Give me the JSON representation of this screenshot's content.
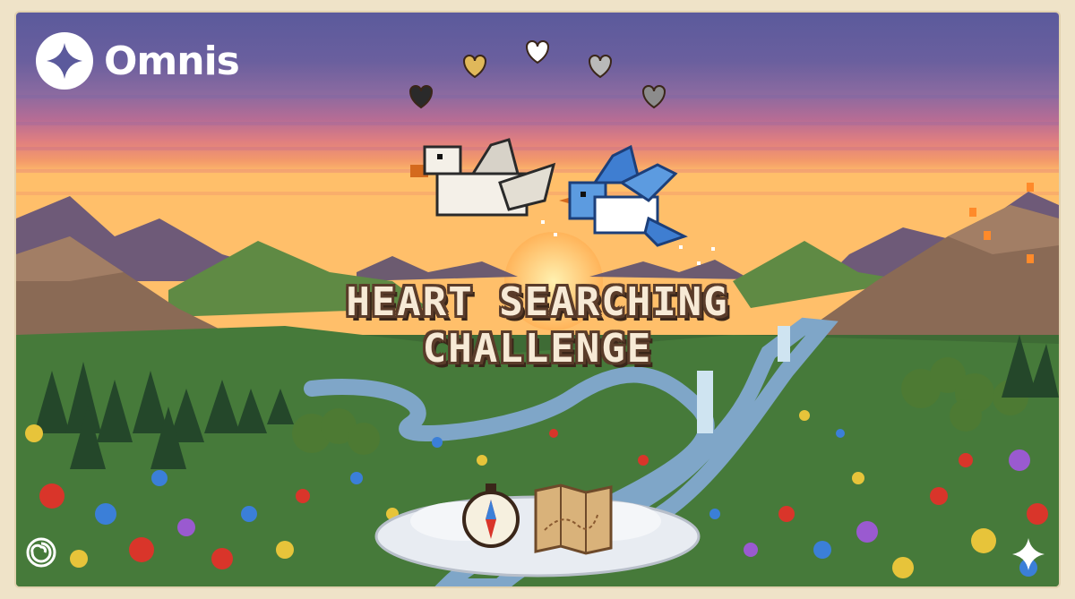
{
  "brand": {
    "name": "Omnis",
    "logo": "four-point-star-icon"
  },
  "title": {
    "line1": "HEART SEARCHING",
    "line2": "CHALLENGE"
  },
  "hearts": [
    {
      "color": "#e0b85a"
    },
    {
      "color": "#ffffff"
    },
    {
      "color": "#b9b9b9"
    },
    {
      "color": "#2a2a2a"
    },
    {
      "color": "#8c8c8c"
    }
  ],
  "colors": {
    "sky_top": "#5b5a9c",
    "sky_mid": "#a0679a",
    "sky_low": "#f08a6e",
    "sun": "#ffc26a",
    "mountain": "#8a6a55",
    "meadow": "#3e6b35"
  },
  "items": [
    {
      "icon": "compass-icon"
    },
    {
      "icon": "treasure-map-icon"
    }
  ],
  "corner_icons": [
    "swirl-icon",
    "sparkle-icon"
  ]
}
